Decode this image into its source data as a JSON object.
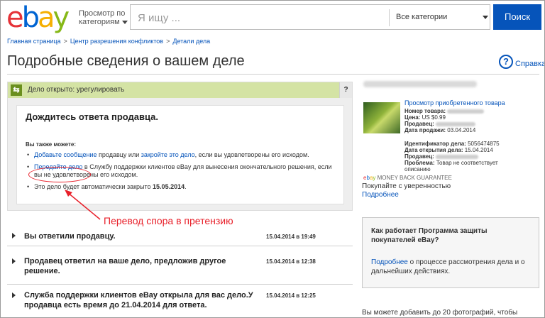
{
  "header": {
    "logo_letters": [
      {
        "ch": "e",
        "color": "#e53238"
      },
      {
        "ch": "b",
        "color": "#0064d2"
      },
      {
        "ch": "a",
        "color": "#f5af02"
      },
      {
        "ch": "y",
        "color": "#86b817"
      }
    ],
    "browse_label": "Просмотр по категориям",
    "search_placeholder": "Я ищу ...",
    "category_value": "Все категории",
    "search_button": "Поиск"
  },
  "breadcrumb": {
    "items": [
      "Главная страница",
      "Центр разрешения конфликтов",
      "Детали дела"
    ],
    "separator": ">"
  },
  "page_title": "Подробные сведения о вашем деле",
  "help_link": "Справка",
  "status": {
    "text": "Дело открыто: урегулировать",
    "help": "?"
  },
  "wait": {
    "title": "Дождитесь ответа продавца.",
    "also_label": "Вы также можете:",
    "opt1_link1": "Добавьте сообщение",
    "opt1_mid": " продавцу или ",
    "opt1_link2": "закройте это дело",
    "opt1_rest": ", если вы удовлетворены его исходом.",
    "opt2_link": "Передайте дело",
    "opt2_rest": " в Службу поддержки клиентов eBay для вынесения окончательного решения, если вы не удовлетворены его исходом.",
    "opt3_text": "Это дело будет автоматически закрыто ",
    "opt3_date": "15.05.2014",
    "opt3_end": "."
  },
  "annotation": {
    "label": "Перевод спора в претензию",
    "color": "#e8202a"
  },
  "history": [
    {
      "text": "Вы ответили продавцу.",
      "date": "15.04.2014 в 19:49"
    },
    {
      "text": "Продавец ответил на ваше дело, предложив другое решение.",
      "date": "15.04.2014 в 12:38"
    },
    {
      "text": "Служба поддержки клиентов eBay открыла для вас дело.У продавца есть время до 21.04.2014 для ответа.",
      "date": "15.04.2014 в 12:25"
    }
  ],
  "item": {
    "view_link": "Просмотр приобретенного товара",
    "item_number_label": "Номер товара:",
    "price_label": "Цена:",
    "price_value": "US $0.99",
    "seller_label": "Продавец:",
    "sale_date_label": "Дата продажи:",
    "sale_date_value": "03.04.2014"
  },
  "case": {
    "id_label": "Идентификатор дела:",
    "id_value": "5056474875",
    "open_date_label": "Дата открытия дела:",
    "open_date_value": "15.04.2014",
    "seller_label": "Продавец:",
    "problem_label": "Проблема:",
    "problem_value": "Товар не соответствует описанию"
  },
  "guarantee": {
    "badge": "MONEY BACK GUARANTEE",
    "buy_confident": "Покупайте с уверенностью",
    "more": "Подробнее"
  },
  "protect": {
    "title": "Как работает Программа защиты покупателей eBay?",
    "link": "Подробнее",
    "desc_rest": " о процессе рассмотрения дела и о дальнейших действиях."
  },
  "photo_note": "Вы можете добавить до 20 фотографий, чтобы"
}
